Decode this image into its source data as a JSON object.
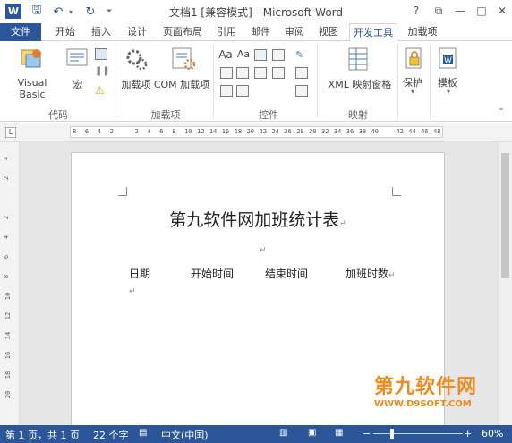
{
  "window": {
    "title": "文档1 [兼容模式] - Microsoft Word",
    "logo": "W",
    "qat": [
      {
        "name": "save-icon",
        "glyph": "🖫"
      },
      {
        "name": "undo-icon",
        "glyph": "↶"
      },
      {
        "name": "redo-icon",
        "glyph": "↻"
      },
      {
        "name": "customize-icon",
        "glyph": "⏷"
      }
    ],
    "controls": {
      "help": "?",
      "restore": "⧉",
      "minimize": "—",
      "maximize": "□",
      "close": "✕"
    }
  },
  "tabs": [
    "文件",
    "开始",
    "插入",
    "设计",
    "页面布局",
    "引用",
    "邮件",
    "审阅",
    "视图",
    "开发工具",
    "加载项"
  ],
  "ribbon": {
    "groups": {
      "code": "代码",
      "addins": "加载项",
      "controls": "控件",
      "mapping": "映射",
      "protect": "",
      "templates": ""
    },
    "buttons": {
      "visual_basic": "Visual Basic",
      "macro": "宏",
      "addin": "加载项",
      "com_addin": "COM 加载项",
      "xml_mapping": "XML 映射窗格",
      "protect": "保护",
      "template": "模板"
    },
    "control_glyphs": {
      "aa1": "Aa",
      "aa2": "Aa"
    }
  },
  "ruler": {
    "corner": "L",
    "ticks": [
      "8",
      "6",
      "4",
      "2",
      "",
      "2",
      "4",
      "6",
      "8",
      "10",
      "12",
      "14",
      "16",
      "18",
      "20",
      "22",
      "24",
      "26",
      "28",
      "30",
      "32",
      "34",
      "36",
      "38",
      "40",
      "",
      "42",
      "44",
      "46",
      "48"
    ],
    "vticks": [
      "4",
      "2",
      "",
      "2",
      "4",
      "6",
      "8",
      "10",
      "12",
      "14",
      "16",
      "18",
      "20"
    ]
  },
  "document": {
    "heading": "第九软件网加班统计表",
    "pilcrow": "↵",
    "columns": [
      "日期",
      "开始时间",
      "结束时间",
      "加班时数"
    ]
  },
  "watermark": {
    "text": "第九软件网",
    "url": "WWW.D9SOFT.COM"
  },
  "status": {
    "page": "第 1 页，共 1 页",
    "words": "22 个字",
    "language": "中文(中国)",
    "zoom": "60%",
    "minus": "−",
    "plus": "+"
  },
  "colors": {
    "brand": "#2b579a",
    "watermark": "#f08a1e"
  }
}
